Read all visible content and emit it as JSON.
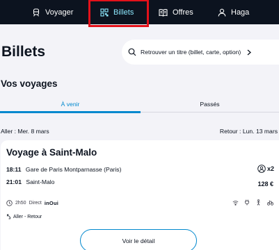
{
  "nav": {
    "items": [
      {
        "label": "Voyager",
        "icon": "train-icon",
        "selected": false
      },
      {
        "label": "Billets",
        "icon": "tickets-icon",
        "selected": true
      },
      {
        "label": "Offres",
        "icon": "book-icon",
        "selected": false
      },
      {
        "label": "Haga",
        "icon": "user-icon",
        "selected": false
      }
    ],
    "highlight_color": "#e3111a"
  },
  "page": {
    "title": "Billets"
  },
  "search": {
    "label": "Retrouver un titre (billet, carte, option)",
    "icon": "search-icon"
  },
  "section": {
    "title": "Vos voyages"
  },
  "tabs": {
    "upcoming": "À venir",
    "past": "Passés",
    "active": "upcoming"
  },
  "dates": {
    "outbound": "Aller : Mer. 8 mars",
    "return": "Retour : Lun. 13 mars"
  },
  "trip": {
    "title": "Voyage à Saint-Malo",
    "departure_time": "18:11",
    "departure_station": "Gare de Paris Montparnasse (Paris)",
    "arrival_time": "21:01",
    "arrival_station": "Saint-Malo",
    "passengers": "x2",
    "price": "128 €",
    "duration": "2h50",
    "direct": "Direct",
    "brand": "inOui",
    "trip_type": "Aller - Retour",
    "amenities": [
      "wifi-icon",
      "plug-icon",
      "bike-icon",
      "accessibility-icon"
    ],
    "detail_button": "Voir le détail"
  },
  "colors": {
    "nav_bg": "#0c131f",
    "accent": "#0088ce",
    "selected_nav": "#8de8fe",
    "page_bg": "#f3f3f8"
  }
}
